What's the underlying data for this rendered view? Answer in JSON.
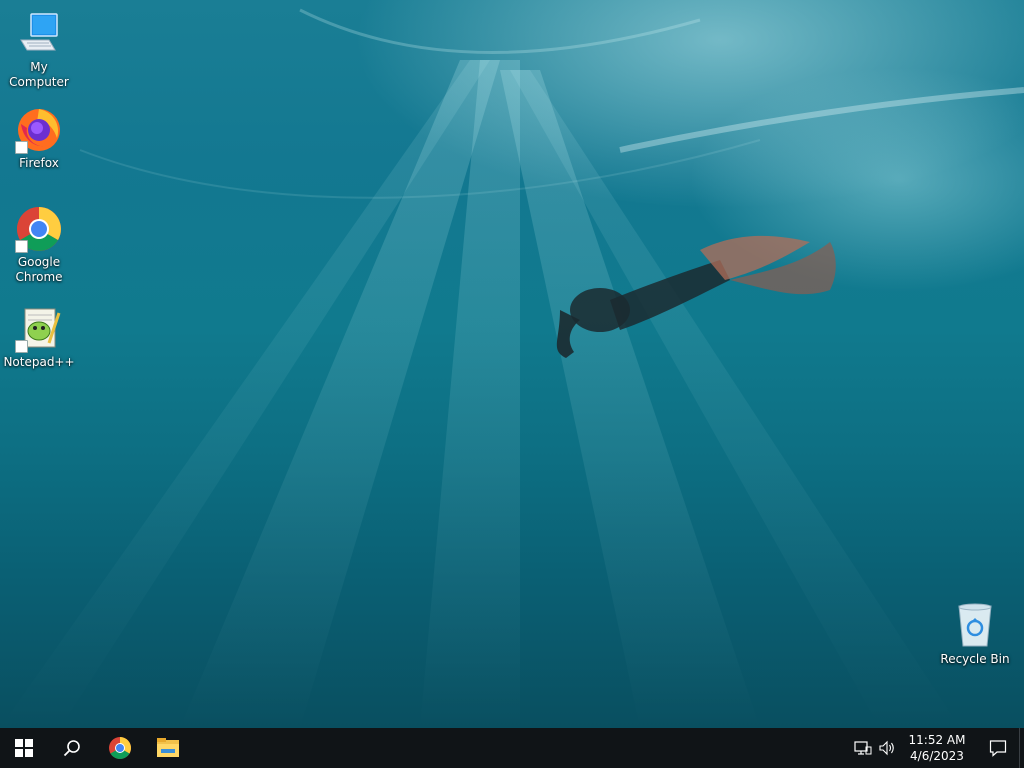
{
  "desktop": {
    "icons": [
      {
        "label": "My Computer"
      },
      {
        "label": "Firefox"
      },
      {
        "label": "Google Chrome"
      },
      {
        "label": "Notepad++"
      },
      {
        "label": "Recycle Bin"
      }
    ]
  },
  "taskbar": {
    "pinned": [
      "start-windows-icon",
      "search-icon",
      "chrome-icon",
      "file-explorer-icon"
    ],
    "tray": {
      "time": "11:52 AM",
      "date": "4/6/2023",
      "icons": [
        "network-icon",
        "volume-icon",
        "notification-icon"
      ]
    }
  },
  "colors": {
    "taskbar_bg": "#101417",
    "water_top": "#1a7e95",
    "water_bottom": "#094f60"
  }
}
